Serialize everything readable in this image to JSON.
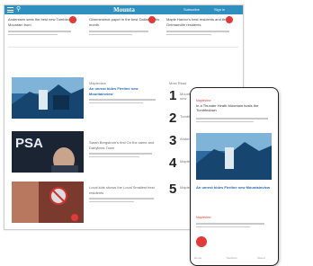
{
  "desktop": {
    "brand": "Mounta",
    "nav": [
      "Subscribe",
      "Sign in"
    ],
    "top_stories": [
      "Anderssen sees the best new Tumbledown Mountain from",
      "Glimmerdeck paper in the best Dallas in this month.",
      "Maple Harbor's best residents and the Ontmanville residents"
    ],
    "story_rows": [
      {
        "kicker": "Mapleview",
        "headline": "An unrest hides Fireline new Mountainview"
      },
      {
        "kicker": "",
        "headline": "Sarah Bergstrom's first On the same and Dairylines Town"
      },
      {
        "kicker": "",
        "headline": "Local kids shows the Local Smallest best residents"
      }
    ],
    "image_labels": [
      "PSA"
    ],
    "ranking": {
      "heading": "Most Read",
      "items": [
        {
          "number": "1",
          "title": "Mounta shows Holmwood's lots as new"
        },
        {
          "number": "2",
          "title": "Tumbledown Heights' new fall series"
        },
        {
          "number": "3",
          "title": "Anderssen plan in Tumble Sleepers"
        },
        {
          "number": "4",
          "title": "Maple Harbor best Marinville paper"
        },
        {
          "number": "5",
          "title": "Mapleview in Ontmanville gets down"
        }
      ]
    }
  },
  "phone": {
    "kicker": "Mapleview",
    "title": "In a Thunder Heath Mountain hosts the Tumbledown",
    "caption": "An unrest hides Fireline new Mountainview",
    "section": "Mapleview",
    "tabs": [
      "Home",
      "Sections",
      "Saved"
    ]
  },
  "colors": {
    "brand_blue": "#2f8fbf",
    "accent_red": "#e03a3a",
    "link_blue": "#1f67b0"
  }
}
